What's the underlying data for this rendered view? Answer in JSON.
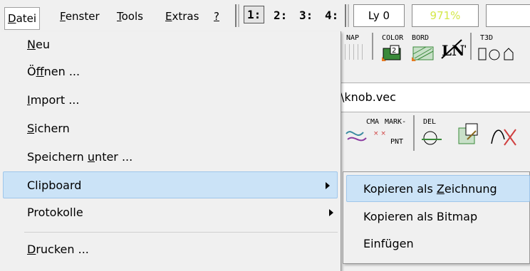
{
  "menubar": {
    "items": [
      {
        "pre": "",
        "key": "D",
        "post": "atei"
      },
      {
        "pre": "",
        "key": "F",
        "post": "enster"
      },
      {
        "pre": "",
        "key": "T",
        "post": "ools"
      },
      {
        "pre": "",
        "key": "E",
        "post": "xtras"
      },
      {
        "pre": "",
        "key": "?",
        "post": ""
      }
    ]
  },
  "toolbar": {
    "view_buttons": [
      "1:",
      "2:",
      "3:",
      "4:"
    ],
    "layer_field": "Ly 0",
    "zoom_field": "971%",
    "zoom_color": "#d4e84a",
    "labels": {
      "snap": "NAP",
      "color": "COLOR",
      "bord": "BORD",
      "lnt": "LNT",
      "t3d": "T3D",
      "cma": "CMA",
      "mark": "MARK-",
      "pnt": "PNT",
      "del": "DEL"
    }
  },
  "document": {
    "path": "\\knob.vec"
  },
  "file_menu": {
    "items": [
      {
        "pre": "",
        "key": "N",
        "post": "eu"
      },
      {
        "pre": "Ö",
        "key": "f",
        "post": "fnen ..."
      },
      {
        "pre": "",
        "key": "I",
        "post": "mport ..."
      },
      {
        "pre": "",
        "key": "S",
        "post": "ichern"
      },
      {
        "pre": "Speichern ",
        "key": "u",
        "post": "nter ..."
      },
      {
        "pre": "Clipboard",
        "key": "",
        "post": ""
      },
      {
        "pre": "Protokolle",
        "key": "",
        "post": ""
      },
      {
        "pre": "",
        "key": "D",
        "post": "rucken ..."
      }
    ]
  },
  "clipboard_submenu": {
    "items": [
      {
        "pre": "Kopieren als ",
        "key": "Z",
        "post": "eichnung"
      },
      {
        "pre": "Kopieren als Bitmap",
        "key": "",
        "post": ""
      },
      {
        "pre": "Einfügen",
        "key": "",
        "post": ""
      }
    ]
  },
  "colors": {
    "highlight": "#cbe3f7",
    "highlight_border": "#9fc6ea",
    "menu_bg": "#f0f0f0"
  }
}
